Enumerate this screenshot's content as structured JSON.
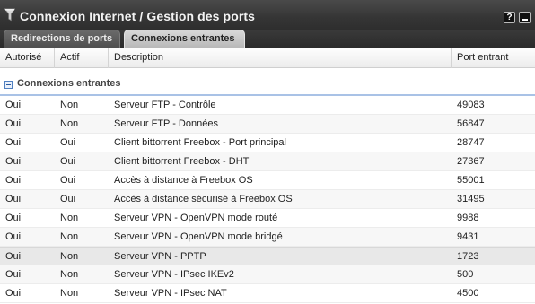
{
  "window": {
    "title": "Connexion Internet / Gestion des ports",
    "help_label": "?"
  },
  "tabs": [
    {
      "label": "Redirections de ports",
      "active": false
    },
    {
      "label": "Connexions entrantes",
      "active": true
    }
  ],
  "table": {
    "columns": [
      "Autorisé",
      "Actif",
      "Description",
      "Port entrant"
    ],
    "group_label": "Connexions entrantes",
    "rows": [
      {
        "autorise": "Oui",
        "actif": "Non",
        "description": "Serveur FTP - Contrôle",
        "port": "49083"
      },
      {
        "autorise": "Oui",
        "actif": "Non",
        "description": "Serveur FTP - Données",
        "port": "56847"
      },
      {
        "autorise": "Oui",
        "actif": "Oui",
        "description": "Client bittorrent Freebox - Port principal",
        "port": "28747"
      },
      {
        "autorise": "Oui",
        "actif": "Oui",
        "description": "Client bittorrent Freebox - DHT",
        "port": "27367"
      },
      {
        "autorise": "Oui",
        "actif": "Oui",
        "description": "Accès à distance à Freebox OS",
        "port": "55001"
      },
      {
        "autorise": "Oui",
        "actif": "Oui",
        "description": "Accès à distance sécurisé à Freebox OS",
        "port": "31495"
      },
      {
        "autorise": "Oui",
        "actif": "Non",
        "description": "Serveur VPN - OpenVPN mode routé",
        "port": "9988"
      },
      {
        "autorise": "Oui",
        "actif": "Non",
        "description": "Serveur VPN - OpenVPN mode bridgé",
        "port": "9431"
      },
      {
        "autorise": "Oui",
        "actif": "Non",
        "description": "Serveur VPN - PPTP",
        "port": "1723"
      },
      {
        "autorise": "Oui",
        "actif": "Non",
        "description": "Serveur VPN - IPsec IKEv2",
        "port": "500"
      },
      {
        "autorise": "Oui",
        "actif": "Non",
        "description": "Serveur VPN - IPsec NAT",
        "port": "4500"
      }
    ]
  },
  "icons": {
    "title_icon": "funnel-icon",
    "help": "help-icon",
    "minimize": "minimize-icon",
    "group_toggle": "collapse-minus-icon"
  },
  "colors": {
    "titlebar": "#353535",
    "active_tab": "#c8c8c8",
    "group_underline": "#a9c2e6"
  }
}
